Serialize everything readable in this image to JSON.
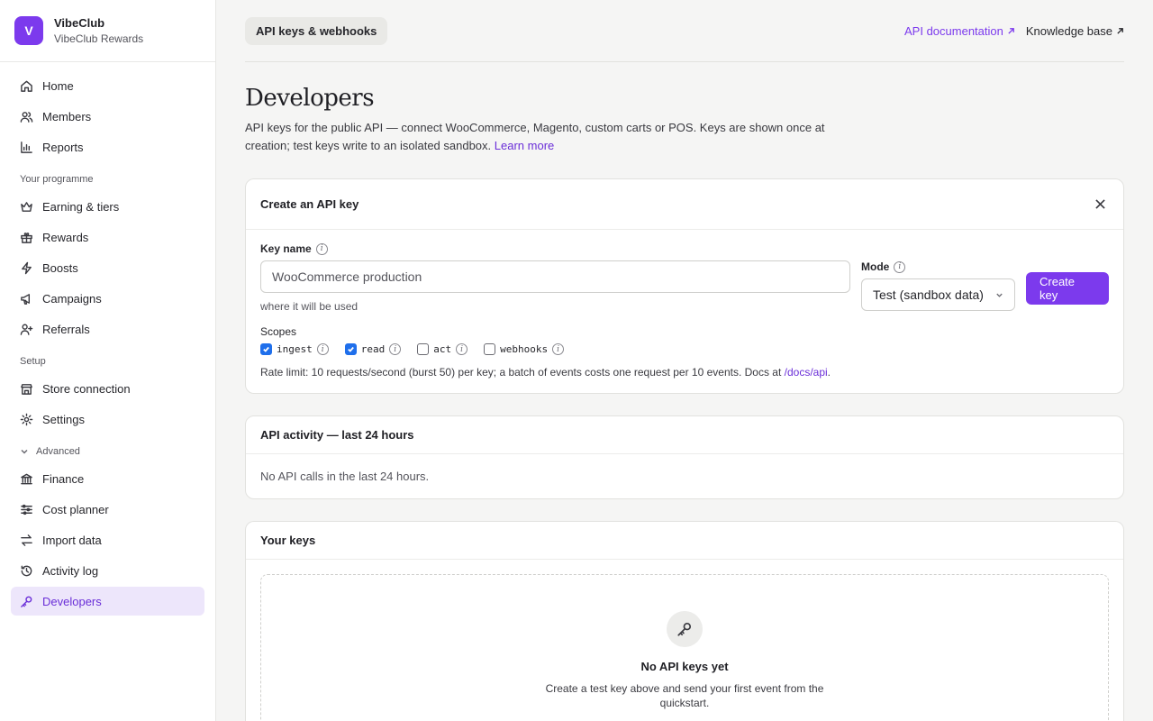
{
  "brand": {
    "initial": "V",
    "name": "VibeClub",
    "subtitle": "VibeClub Rewards",
    "color": "#7c3aed"
  },
  "nav": {
    "main": [
      {
        "label": "Home",
        "icon": "home-icon"
      },
      {
        "label": "Members",
        "icon": "users-icon"
      },
      {
        "label": "Reports",
        "icon": "bar-chart-icon"
      }
    ],
    "programme_title": "Your programme",
    "programme": [
      {
        "label": "Earning & tiers",
        "icon": "crown-icon"
      },
      {
        "label": "Rewards",
        "icon": "gift-icon"
      },
      {
        "label": "Boosts",
        "icon": "bolt-icon"
      },
      {
        "label": "Campaigns",
        "icon": "megaphone-icon"
      },
      {
        "label": "Referrals",
        "icon": "user-plus-icon"
      }
    ],
    "setup_title": "Setup",
    "setup": [
      {
        "label": "Store connection",
        "icon": "store-icon"
      },
      {
        "label": "Settings",
        "icon": "gear-icon"
      }
    ],
    "advanced_title": "Advanced",
    "advanced": [
      {
        "label": "Finance",
        "icon": "bank-icon"
      },
      {
        "label": "Cost planner",
        "icon": "sliders-icon"
      },
      {
        "label": "Import data",
        "icon": "arrows-icon"
      },
      {
        "label": "Activity log",
        "icon": "history-icon"
      },
      {
        "label": "Developers",
        "icon": "key-icon",
        "active": true
      }
    ]
  },
  "topbar": {
    "tab": "API keys & webhooks",
    "links": [
      {
        "label": "API documentation",
        "accent": true
      },
      {
        "label": "Knowledge base",
        "accent": false
      }
    ]
  },
  "page": {
    "title": "Developers",
    "description": "API keys for the public API — connect WooCommerce, Magento, custom carts or POS. Keys are shown once at creation; test keys write to an isolated sandbox.",
    "learn_more": "Learn more"
  },
  "create_card": {
    "title": "Create an API key",
    "key_name_label": "Key name",
    "key_name_value": "WooCommerce production",
    "key_name_help": "where it will be used",
    "mode_label": "Mode",
    "mode_value": "Test (sandbox data)",
    "create_button": "Create key",
    "scopes_label": "Scopes",
    "scopes": [
      {
        "name": "ingest",
        "checked": true
      },
      {
        "name": "read",
        "checked": true
      },
      {
        "name": "act",
        "checked": false
      },
      {
        "name": "webhooks",
        "checked": false
      }
    ],
    "rate_text": "Rate limit: 10 requests/second (burst 50) per key; a batch of events costs one request per 10 events. Docs at ",
    "rate_link": "/docs/api",
    "rate_end": "."
  },
  "activity_card": {
    "title": "API activity — last 24 hours",
    "empty": "No API calls in the last 24 hours."
  },
  "keys_card": {
    "title": "Your keys",
    "empty_title": "No API keys yet",
    "empty_sub": "Create a test key above and send your first event from the quickstart."
  },
  "colors": {
    "accent": "#7c3aed",
    "active_bg": "#ede6fb",
    "checkbox": "#1f6feb"
  }
}
